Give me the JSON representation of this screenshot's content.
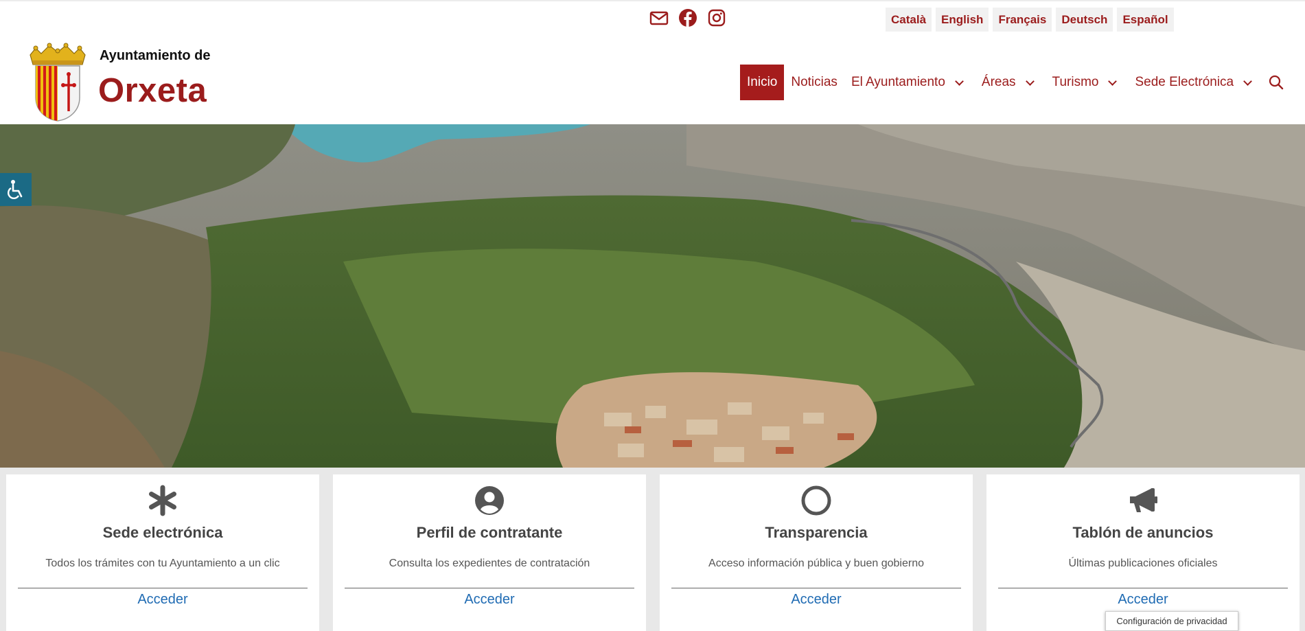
{
  "header": {
    "brand_sub": "Ayuntamiento de",
    "brand_name": "Orxeta",
    "social": [
      "email-icon",
      "facebook-icon",
      "instagram-icon"
    ],
    "languages": [
      "Català",
      "English",
      "Français",
      "Deutsch",
      "Español"
    ]
  },
  "nav": {
    "items": [
      {
        "label": "Inicio",
        "active": true
      },
      {
        "label": "Noticias"
      },
      {
        "label": "El Ayuntamiento",
        "dropdown": true
      },
      {
        "label": "Áreas",
        "dropdown": true
      },
      {
        "label": "Turismo",
        "dropdown": true
      },
      {
        "label": "Sede Electrónica",
        "dropdown": true
      }
    ],
    "search_icon": "search-icon"
  },
  "cards": [
    {
      "icon": "asterisk-icon",
      "title": "Sede electrónica",
      "desc": "Todos los trámites con tu Ayuntamiento a un clic",
      "link": "Acceder"
    },
    {
      "icon": "user-circle-icon",
      "title": "Perfil de contratante",
      "desc": "Consulta los expedientes de contratación",
      "link": "Acceder"
    },
    {
      "icon": "circle-icon",
      "title": "Transparencia",
      "desc": "Acceso información pública y buen gobierno",
      "link": "Acceder"
    },
    {
      "icon": "megaphone-icon",
      "title": "Tablón de anuncios",
      "desc": "Últimas publicaciones oficiales",
      "link": "Acceder"
    }
  ],
  "privacy_label": "Configuración de privacidad",
  "colors": {
    "brand": "#9b1c1c",
    "link": "#1f6bb3",
    "accessibility": "#1b6a85"
  }
}
